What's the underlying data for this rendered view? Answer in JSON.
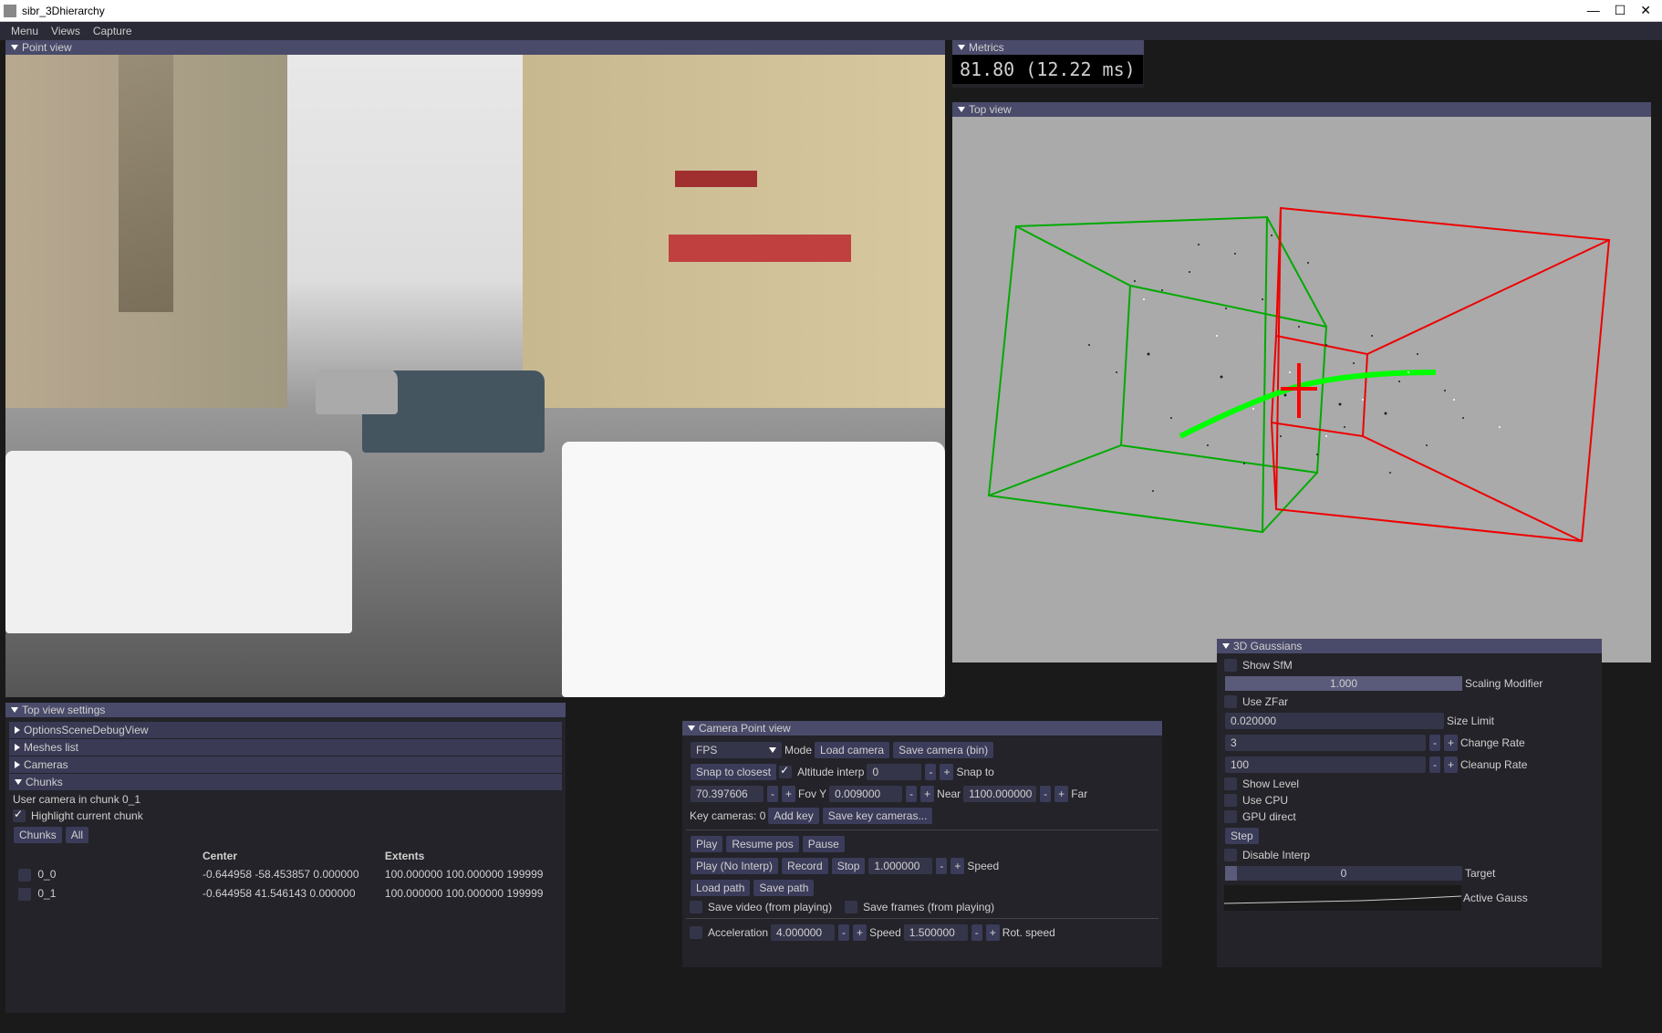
{
  "window": {
    "title": "sibr_3Dhierarchy",
    "min": "—",
    "max": "☐",
    "close": "✕"
  },
  "menubar": [
    "Menu",
    "Views",
    "Capture"
  ],
  "point_view": {
    "title": "Point view"
  },
  "metrics": {
    "title": "Metrics",
    "value": "81.80 (12.22 ms)"
  },
  "top_view": {
    "title": "Top view"
  },
  "top_settings": {
    "title": "Top view settings",
    "sub1": "OptionsSceneDebugView",
    "sub2": "Meshes list",
    "sub3": "Cameras",
    "sub4": "Chunks",
    "user_camera": "User camera in chunk 0_1",
    "highlight": "Highlight current chunk",
    "chunks_btn": "Chunks",
    "all_btn": "All",
    "table": {
      "headers": [
        "",
        "Center",
        "Extents"
      ],
      "rows": [
        {
          "name": "0_0",
          "center": "-0.644958 -58.453857 0.000000",
          "extents": "100.000000 100.000000 199999"
        },
        {
          "name": "0_1",
          "center": "-0.644958 41.546143 0.000000",
          "extents": "100.000000 100.000000 199999"
        }
      ]
    }
  },
  "camera": {
    "title": "Camera Point view",
    "mode_sel": "FPS",
    "mode_lbl": "Mode",
    "load": "Load camera",
    "save": "Save camera (bin)",
    "snap": "Snap to closest",
    "alt_interp": "Altitude interp",
    "alt_val": "0",
    "snap_to": "Snap to",
    "fov_val": "70.397606",
    "fovy": "Fov Y",
    "fovy_val": "0.009000",
    "near": "Near",
    "near_val": "1100.000000",
    "far": "Far",
    "keycam": "Key cameras: 0",
    "add_key": "Add key",
    "save_key": "Save key cameras...",
    "play": "Play",
    "resume": "Resume pos",
    "pause": "Pause",
    "play_ni": "Play (No Interp)",
    "record": "Record",
    "stop": "Stop",
    "speed_val": "1.000000",
    "speed": "Speed",
    "load_path": "Load path",
    "save_path": "Save path",
    "save_video": "Save video (from playing)",
    "save_frames": "Save frames (from playing)",
    "accel": "Acceleration",
    "accel_val": "4.000000",
    "speed2": "Speed",
    "speed2_val": "1.500000",
    "rot": "Rot. speed"
  },
  "gaussians": {
    "title": "3D Gaussians",
    "show_sfm": "Show SfM",
    "scaling_val": "1.000",
    "scaling": "Scaling Modifier",
    "use_zfar": "Use ZFar",
    "size_val": "0.020000",
    "size": "Size Limit",
    "change_val": "3",
    "change": "Change Rate",
    "cleanup_val": "100",
    "cleanup": "Cleanup Rate",
    "show_level": "Show Level",
    "use_cpu": "Use CPU",
    "gpu_direct": "GPU direct",
    "step": "Step",
    "disable_interp": "Disable Interp",
    "target_val": "0",
    "target": "Target",
    "active": "Active Gauss"
  }
}
